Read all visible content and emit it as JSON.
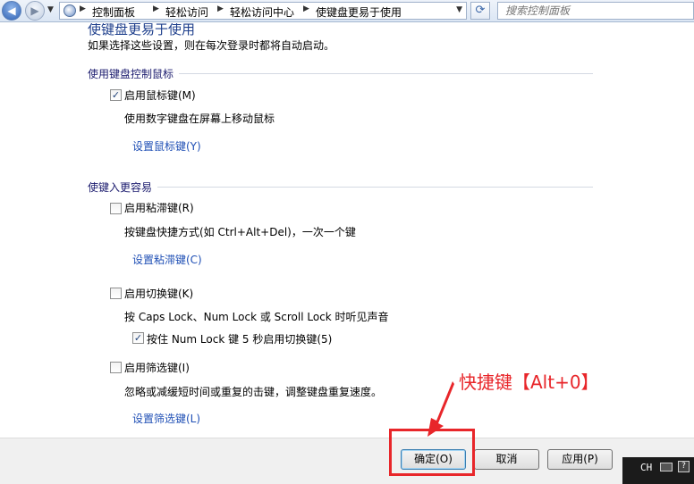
{
  "address_bar": {
    "breadcrumbs": [
      "控制面板",
      "轻松访问",
      "轻松访问中心",
      "使键盘更易于使用"
    ],
    "search_placeholder": "搜索控制面板"
  },
  "intro": {
    "heading": "使键盘更易于使用",
    "subtitle": "如果选择这些设置，则在每次登录时都将自动启动。"
  },
  "mouse_section": {
    "title": "使用键盘控制鼠标",
    "mouse_keys": {
      "label": "启用鼠标键(M)",
      "checked": true,
      "description": "使用数字键盘在屏幕上移动鼠标",
      "link": "设置鼠标键(Y)"
    }
  },
  "typing_section": {
    "title": "使键入更容易",
    "sticky_keys": {
      "label": "启用粘滞键(R)",
      "checked": false,
      "description": "按键盘快捷方式(如 Ctrl+Alt+Del)，一次一个键",
      "link": "设置粘滞键(C)"
    },
    "toggle_keys": {
      "label": "启用切换键(K)",
      "checked": false,
      "description": "按 Caps Lock、Num Lock 或 Scroll Lock 时听见声音",
      "sub_option": {
        "label": "按住 Num Lock 键 5 秒启用切换键(5)",
        "checked": true
      }
    },
    "filter_keys": {
      "label": "启用筛选键(I)",
      "checked": false,
      "description": "忽略或减缓短时间或重复的击键，调整键盘重复速度。",
      "link": "设置筛选键(L)"
    }
  },
  "buttons": {
    "ok": "确定(O)",
    "cancel": "取消",
    "apply": "应用(P)"
  },
  "annotation": {
    "text": "快捷键【Alt+0】",
    "color": "#e8262a"
  },
  "taskbar": {
    "language": "CH"
  }
}
